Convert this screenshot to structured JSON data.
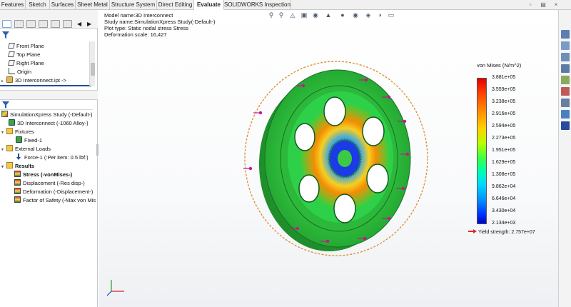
{
  "tabs": [
    {
      "label": "Features"
    },
    {
      "label": "Sketch"
    },
    {
      "label": "Surfaces"
    },
    {
      "label": "Sheet Metal"
    },
    {
      "label": "Structure System"
    },
    {
      "label": "Direct Editing"
    },
    {
      "label": "Evaluate"
    },
    {
      "label": "SOLIDWORKS Inspection"
    }
  ],
  "active_tab": "Evaluate",
  "feature_tree": {
    "items": [
      {
        "label": "Front Plane",
        "icon": "plane-icon"
      },
      {
        "label": "Top Plane",
        "icon": "plane-icon"
      },
      {
        "label": "Right Plane",
        "icon": "plane-icon"
      },
      {
        "label": "Origin",
        "icon": "origin-icon"
      },
      {
        "label": "3D Interconnect.ipt ->",
        "icon": "part-icon"
      }
    ]
  },
  "simulation_tree": {
    "study": "SimulationXpress Study (-Default-)",
    "part": "3D Interconnect (-1060 Alloy-)",
    "fixtures": "Fixtures",
    "fixed": "Fixed-1",
    "external_loads": "External Loads",
    "force": "Force-1 (:Per item: 0.5 lbf:)",
    "results": "Results",
    "result_items": [
      "Stress (-vonMises-)",
      "Displacement (-Res disp-)",
      "Deformation (-Displacement-)",
      "Factor of Safety (-Max von Mis"
    ]
  },
  "viewport_info": {
    "model_name": "Model name:3D Interconnect",
    "study_name": "Study name:SimulationXpress Study(-Default-)",
    "plot_type": "Plot type: Static nodal stress Stress",
    "deformation_scale": "Deformation scale: 16,427"
  },
  "legend": {
    "title": "von Mises (N/m^2)",
    "labels": [
      "3.881e+05",
      "3.559e+05",
      "3.238e+05",
      "2.916e+05",
      "2.594e+05",
      "2.273e+05",
      "1.951e+05",
      "1.629e+05",
      "1.308e+05",
      "9.862e+04",
      "6.646e+04",
      "3.430e+04",
      "2.134e+03"
    ],
    "yield_strength": "Yield strength: 2.757e+07"
  },
  "colors": {
    "accent": "#1f4e9a",
    "stress_high": "#e00000",
    "stress_mid": "#ffd000",
    "stress_low": "#0000c8",
    "load_arrow": "#c2188d",
    "fixture": "#e08a2a"
  }
}
